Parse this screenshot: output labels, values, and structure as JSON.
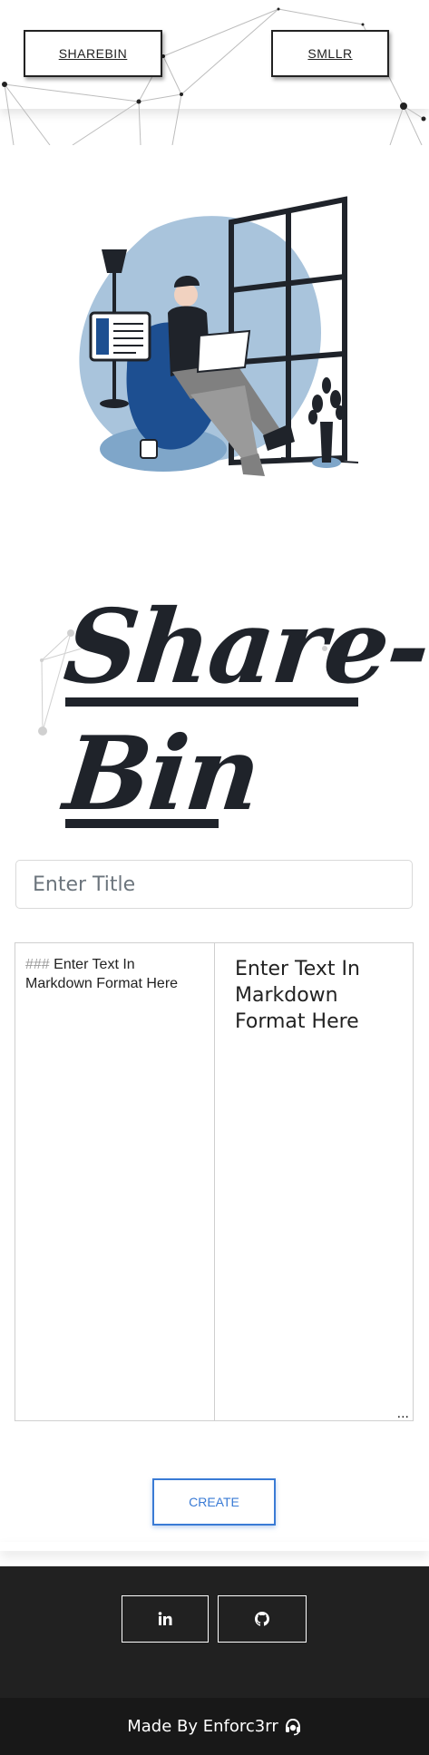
{
  "nav": {
    "sharebin_label": "SHAREBIN",
    "smllr_label": "SMLLR"
  },
  "logo": {
    "line1": "Share-",
    "line2": "Bin"
  },
  "form": {
    "title_placeholder": "Enter Title",
    "markdown_hash": "###",
    "markdown_text": " Enter Text In Markdown Format Here",
    "preview_text": "Enter Text In Markdown Format Here",
    "resize_glyph": "...",
    "create_label": "CREATE"
  },
  "footer": {
    "social_icons": [
      "linkedin-icon",
      "github-icon"
    ],
    "credit": "Made By Enforc3rr"
  },
  "colors": {
    "text_dark": "#1f232a",
    "accent_blue": "#3a7bd5",
    "footer_bg": "#212121",
    "footer_bottom_bg": "#181818",
    "illustration_blue": "#1d4f91",
    "illustration_light": "#a9c4dc"
  }
}
